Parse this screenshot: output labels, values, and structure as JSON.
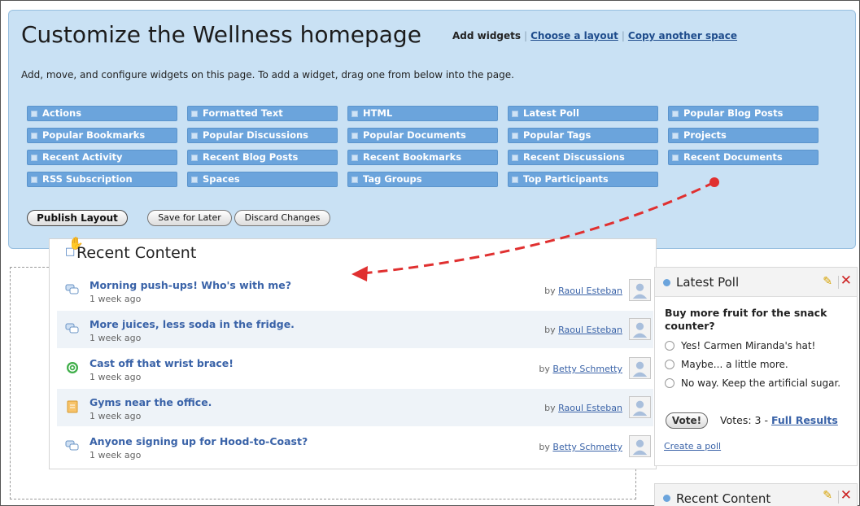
{
  "panel": {
    "title": "Customize the Wellness homepage",
    "add_widgets": "Add widgets",
    "link_sep": "|",
    "choose_layout": "Choose a layout",
    "copy_space": "Copy another space",
    "description": "Add, move, and configure widgets on this page. To add a widget, drag one from below into the page."
  },
  "widgets": [
    "Actions",
    "Formatted Text",
    "HTML",
    "Latest Poll",
    "Popular Blog Posts",
    "Popular Bookmarks",
    "Popular Discussions",
    "Popular Documents",
    "Popular Tags",
    "Projects",
    "Recent Activity",
    "Recent Blog Posts",
    "Recent Bookmarks",
    "Recent Discussions",
    "Recent Documents",
    "RSS Subscription",
    "Spaces",
    "Tag Groups",
    "Top Participants"
  ],
  "buttons": {
    "publish": "Publish Layout",
    "save_later": "Save for Later",
    "discard": "Discard Changes"
  },
  "recent_content": {
    "title": "Recent Content",
    "by_prefix": "by",
    "items": [
      {
        "title": "Morning push-ups! Who's with me?",
        "time": "1 week ago",
        "author": "Raoul Esteban",
        "icon": "discussion-icon"
      },
      {
        "title": "More juices, less soda in the fridge.",
        "time": "1 week ago",
        "author": "Raoul Esteban",
        "icon": "discussion-icon"
      },
      {
        "title": "Cast off that wrist brace!",
        "time": "1 week ago",
        "author": "Betty Schmetty",
        "icon": "blog-post-icon"
      },
      {
        "title": "Gyms near the office.",
        "time": "1 week ago",
        "author": "Raoul Esteban",
        "icon": "document-icon"
      },
      {
        "title": "Anyone signing up for Hood-to-Coast?",
        "time": "1 week ago",
        "author": "Betty Schmetty",
        "icon": "discussion-icon"
      }
    ]
  },
  "poll": {
    "title": "Latest Poll",
    "question": "Buy more fruit for the snack counter?",
    "options": [
      "Yes! Carmen Miranda's hat!",
      "Maybe... a little more.",
      "No way. Keep the artificial sugar."
    ],
    "vote_button": "Vote!",
    "votes_label": "Votes: 3 -",
    "full_results": "Full Results",
    "create_poll": "Create a poll"
  },
  "recent_content_2": {
    "title": "Recent Content"
  },
  "colors": {
    "panel_bg": "#c9e1f4",
    "chip_bg": "#6ba4dc",
    "link": "#3a63a8",
    "arrow": "#e03030"
  }
}
